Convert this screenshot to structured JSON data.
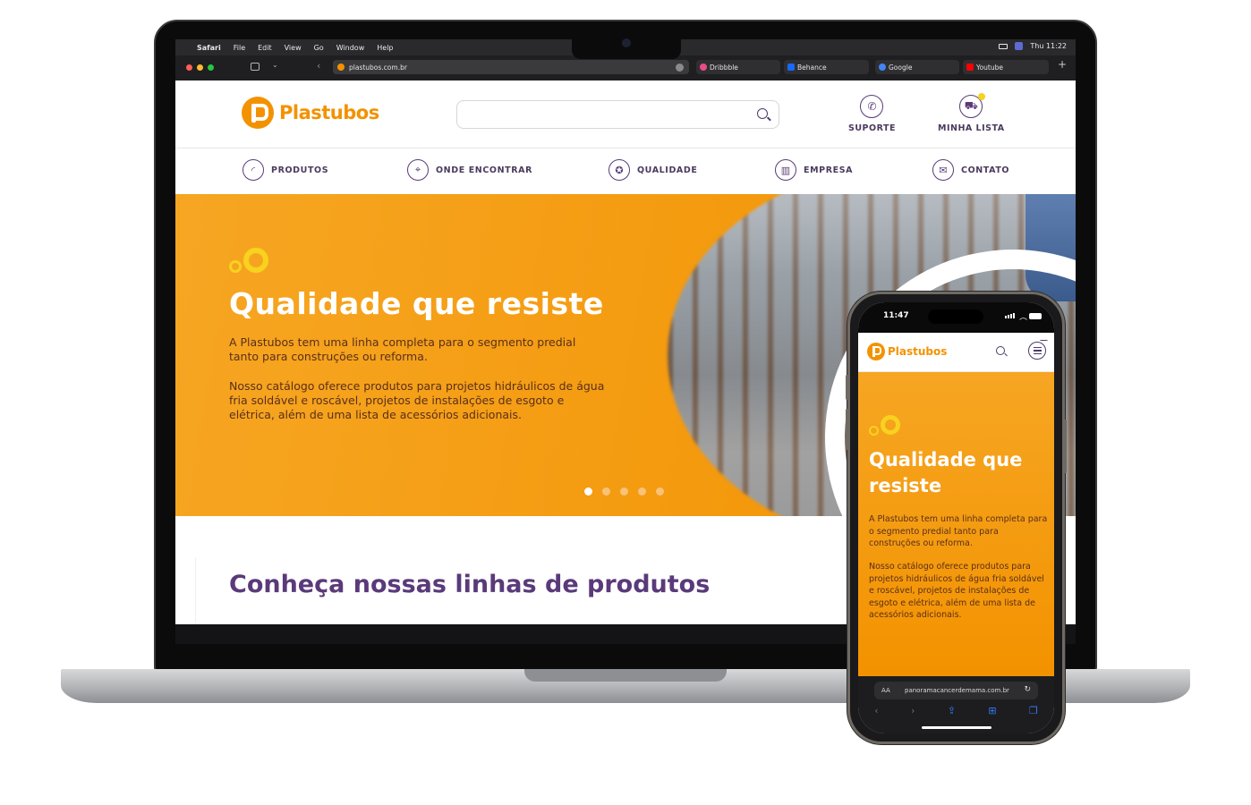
{
  "macos": {
    "menu": [
      "Safari",
      "File",
      "Edit",
      "View",
      "Go",
      "Window",
      "Help"
    ],
    "clock": "Thu 11:22"
  },
  "safari": {
    "url": "plastubos.com.br",
    "tabs": [
      "Dribbble",
      "Behance",
      "Google",
      "Youtube"
    ],
    "tab_colors": [
      "#ea4c89",
      "#1769ff",
      "#4285f4",
      "#ff0000"
    ],
    "new_tab_label": "+"
  },
  "site": {
    "brand": "Plastubos",
    "search_placeholder": "",
    "header_actions": [
      {
        "label": "SUPORTE",
        "icon": "phone-icon"
      },
      {
        "label": "MINHA LISTA",
        "icon": "cart-icon"
      }
    ],
    "nav": [
      {
        "label": "PRODUTOS",
        "icon": "pipe-icon"
      },
      {
        "label": "ONDE ENCONTRAR",
        "icon": "map-pin-icon"
      },
      {
        "label": "QUALIDADE",
        "icon": "award-icon"
      },
      {
        "label": "EMPRESA",
        "icon": "factory-icon"
      },
      {
        "label": "CONTATO",
        "icon": "mail-icon"
      }
    ],
    "hero": {
      "title": "Qualidade que resiste",
      "p1": " A Plastubos tem uma linha completa para o segmento predial tanto para construções ou reforma.",
      "p2": "Nosso catálogo oferece produtos para projetos hidráulicos de água fria soldável e roscável, projetos de instalações de esgoto e elétrica, além de uma lista de acessórios adicionais.",
      "slides": 5,
      "active_slide": 1
    },
    "products_title": "Conheça nossas linhas de produtos"
  },
  "phone": {
    "time": "11:47",
    "brand": "Plastubos",
    "hero_title": "Qualidade que resiste",
    "p1": " A Plastubos tem uma linha completa para o segmento predial tanto para construções ou reforma.",
    "p2": "Nosso catálogo oferece produtos para projetos hidráulicos de água fria soldável e roscável, projetos de instalações de esgoto e elétrica, além de uma lista de acessórios adicionais.",
    "url": "panoramacancerdemama.com.br",
    "aa_label": "AA"
  },
  "colors": {
    "brand_orange": "#f39200",
    "brand_purple": "#5a3a7a",
    "accent_yellow": "#f7d21e"
  }
}
